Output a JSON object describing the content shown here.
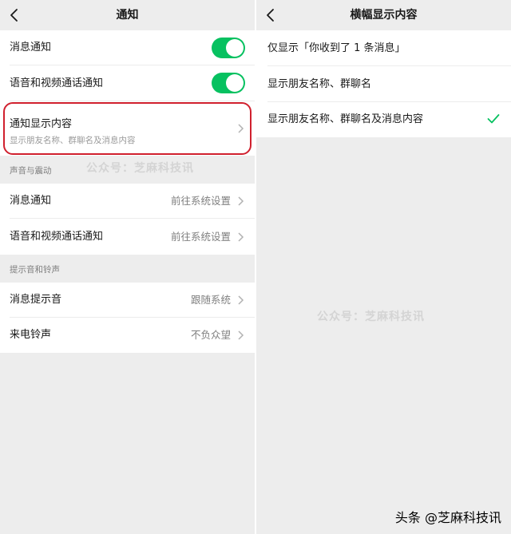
{
  "left": {
    "title": "通知",
    "rows": {
      "msg_notify": "消息通知",
      "call_notify": "语音和视频通话通知",
      "display_content": {
        "label": "通知显示内容",
        "sub": "显示朋友名称、群聊名及消息内容"
      }
    },
    "section_sound": {
      "header": "声音与震动",
      "msg_notify": {
        "label": "消息通知",
        "value": "前往系统设置"
      },
      "call_notify": {
        "label": "语音和视频通话通知",
        "value": "前往系统设置"
      }
    },
    "section_ring": {
      "header": "提示音和铃声",
      "tone": {
        "label": "消息提示音",
        "value": "跟随系统"
      },
      "ringtone": {
        "label": "来电铃声",
        "value": "不负众望"
      }
    },
    "toggles": {
      "msg_notify_on": true,
      "call_notify_on": true
    },
    "watermark": "公众号：芝麻科技讯"
  },
  "right": {
    "title": "横幅显示内容",
    "options": [
      {
        "label": "仅显示「你收到了 1 条消息」",
        "selected": false
      },
      {
        "label": "显示朋友名称、群聊名",
        "selected": false
      },
      {
        "label": "显示朋友名称、群聊名及消息内容",
        "selected": true
      }
    ],
    "watermark": "公众号：芝麻科技讯"
  },
  "brand": "头条 @芝麻科技讯",
  "colors": {
    "accent": "#07c160",
    "highlight": "#d0202e",
    "background": "#ededed"
  }
}
